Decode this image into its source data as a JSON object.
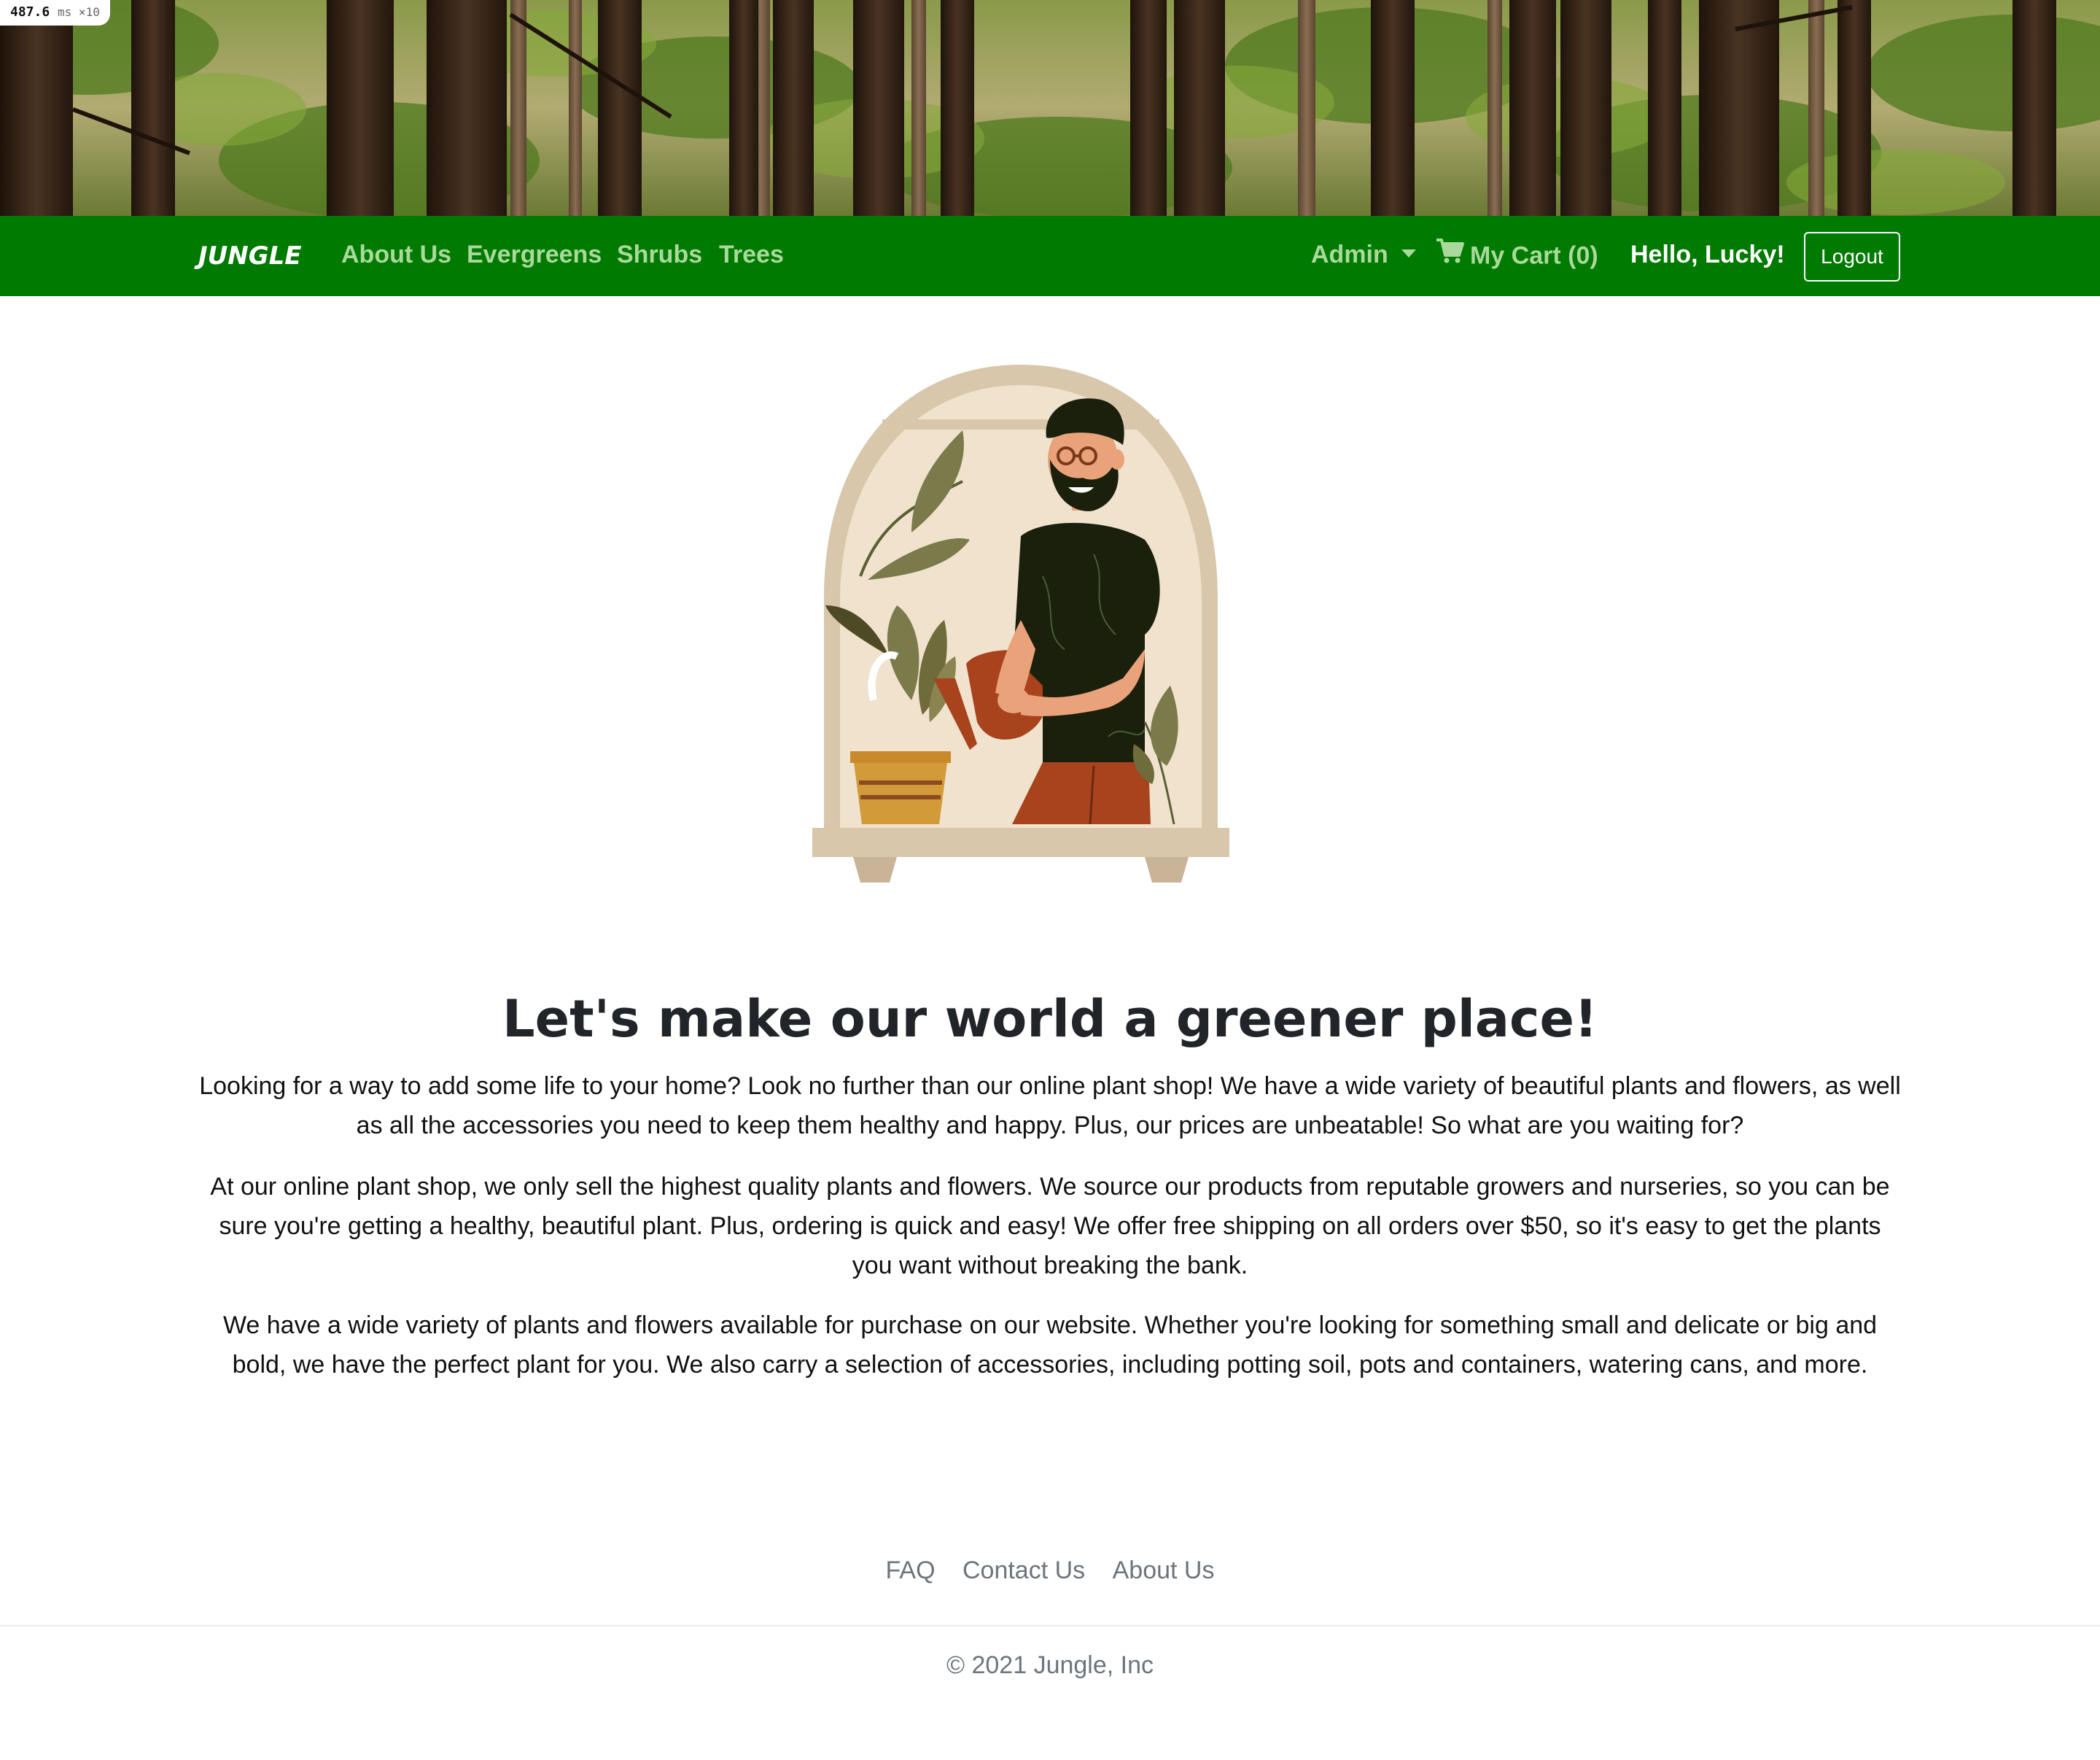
{
  "perf_badge": {
    "value": "487.6",
    "unit": "ms ×10"
  },
  "navbar": {
    "brand": "JUNGLE",
    "links": [
      "About Us",
      "Evergreens",
      "Shrubs",
      "Trees"
    ],
    "admin_label": "Admin",
    "cart_label": "My Cart (0)",
    "greeting": "Hello, Lucky!",
    "logout_label": "Logout"
  },
  "main": {
    "headline": "Let's make our world a greener place!",
    "paragraphs": [
      "Looking for a way to add some life to your home? Look no further than our online plant shop! We have a wide variety of beautiful plants and flowers, as well as all the accessories you need to keep them healthy and happy. Plus, our prices are unbeatable! So what are you waiting for?",
      "At our online plant shop, we only sell the highest quality plants and flowers. We source our products from reputable growers and nurseries, so you can be sure you're getting a healthy, beautiful plant. Plus, ordering is quick and easy! We offer free shipping on all orders over $50, so it's easy to get the plants you want without breaking the bank.",
      "We have a wide variety of plants and flowers available for purchase on our website. Whether you're looking for something small and delicate or big and bold, we have the perfect plant for you. We also carry a selection of accessories, including potting soil, pots and containers, watering cans, and more."
    ]
  },
  "footer": {
    "links": [
      "FAQ",
      "Contact Us",
      "About Us"
    ],
    "copyright": "© 2021 Jungle, Inc"
  },
  "colors": {
    "navbar_bg": "#007a00",
    "nav_link": "#a9d99b",
    "text_dark": "#212529",
    "footer_text": "#6c757d"
  },
  "icons": [
    "cart-icon",
    "caret-down-icon"
  ]
}
